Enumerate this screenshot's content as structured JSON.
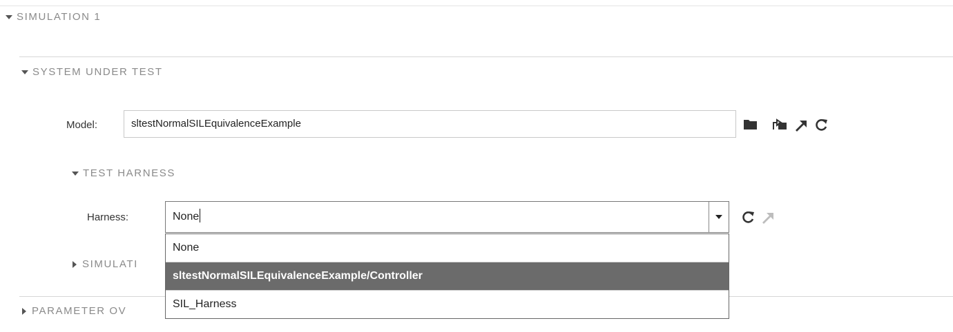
{
  "simulation_section": {
    "title": "SIMULATION 1"
  },
  "system_under_test": {
    "title": "SYSTEM UNDER TEST",
    "model_label": "Model:",
    "model_value": "sltestNormalSILEquivalenceExample",
    "icons": [
      "folder-icon",
      "open-model-icon",
      "navigate-to-icon",
      "refresh-icon"
    ]
  },
  "test_harness": {
    "title": "TEST HARNESS",
    "harness_label": "Harness:",
    "harness_value": "None",
    "options": [
      "None",
      "sltestNormalSILEquivalenceExample/Controller",
      "SIL_Harness"
    ],
    "highlighted_option": "sltestNormalSILEquivalenceExample/Controller",
    "icons": [
      "refresh-icon",
      "navigate-to-icon"
    ]
  },
  "simulation_settings": {
    "title_visible": "SIMULATI"
  },
  "parameter_overrides": {
    "title_visible": "PARAMETER OV"
  },
  "colors": {
    "highlight": "#6b6b6b",
    "header_text": "#8a8a8a",
    "border": "#c8c8c8"
  }
}
